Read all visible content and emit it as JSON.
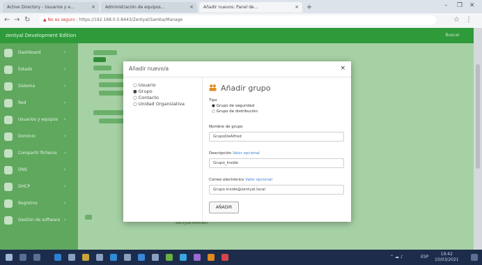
{
  "browser": {
    "tabs": [
      {
        "label": "Active Directory - Usuarios y e..."
      },
      {
        "label": "Administración de equipos..."
      },
      {
        "label": "Añadir nuevos: Panel de..."
      }
    ],
    "new_tab": "+",
    "window_controls": [
      "–",
      "❐",
      "✕"
    ],
    "url_warning": "▲ No es seguro",
    "url": "https://192.168.0.5:8443/Zentyal/Samba/Manage"
  },
  "app": {
    "brand": "zentyal  Development Edition",
    "right_text": "Buscar",
    "sidebar": [
      {
        "icon": "dashboard-icon",
        "label": "Dashboard"
      },
      {
        "icon": "module-icon",
        "label": "Estado"
      },
      {
        "icon": "system-icon",
        "label": "Sistema"
      },
      {
        "icon": "network-icon",
        "label": "Red"
      },
      {
        "icon": "users-icon",
        "label": "Usuarios y equipos"
      },
      {
        "icon": "domain-icon",
        "label": "Dominio"
      },
      {
        "icon": "shares-icon",
        "label": "Compartir ficheros"
      },
      {
        "icon": "dns-icon",
        "label": "DNS"
      },
      {
        "icon": "dhcp-icon",
        "label": "DHCP"
      },
      {
        "icon": "logs-icon",
        "label": "Registros"
      },
      {
        "icon": "software-icon",
        "label": "Gestión de software"
      }
    ],
    "tree_footer": "zentyal-domain"
  },
  "modal": {
    "title": "Añadir nuevo/a",
    "close": "×",
    "types": [
      {
        "mark": "○",
        "label": "Usuario"
      },
      {
        "mark": "●",
        "label": "Grupo"
      },
      {
        "mark": "○",
        "label": "Contacto"
      },
      {
        "mark": "○",
        "label": "Unidad Organizativa"
      }
    ],
    "heading": "Añadir grupo",
    "tipo_label": "Tipo",
    "tipo_options": [
      {
        "mark": "●",
        "label": "Grupo de seguridad"
      },
      {
        "mark": "○",
        "label": "Grupo de distribución"
      }
    ],
    "name_label": "Nombre de grupo",
    "name_value": "GrupoDeAlfred",
    "desc_label": "Descripción",
    "desc_optional": "Valor opcional",
    "desc_value": "Grupo_Inside",
    "email_label": "Correo electrónico",
    "email_optional": "Valor opcional",
    "email_value": "Grupo.inside@zentyal.local",
    "submit": "AÑADIR"
  },
  "taskbar": {
    "tray_text": "ESP",
    "clock_time": "19:42",
    "clock_date": "10/03/2021"
  },
  "colors": {
    "accent_green": "#2f9a3a",
    "sidebar_green": "#5fa85e",
    "taskbar": "#1c2c4a",
    "group_icon": "#e38b1d"
  }
}
